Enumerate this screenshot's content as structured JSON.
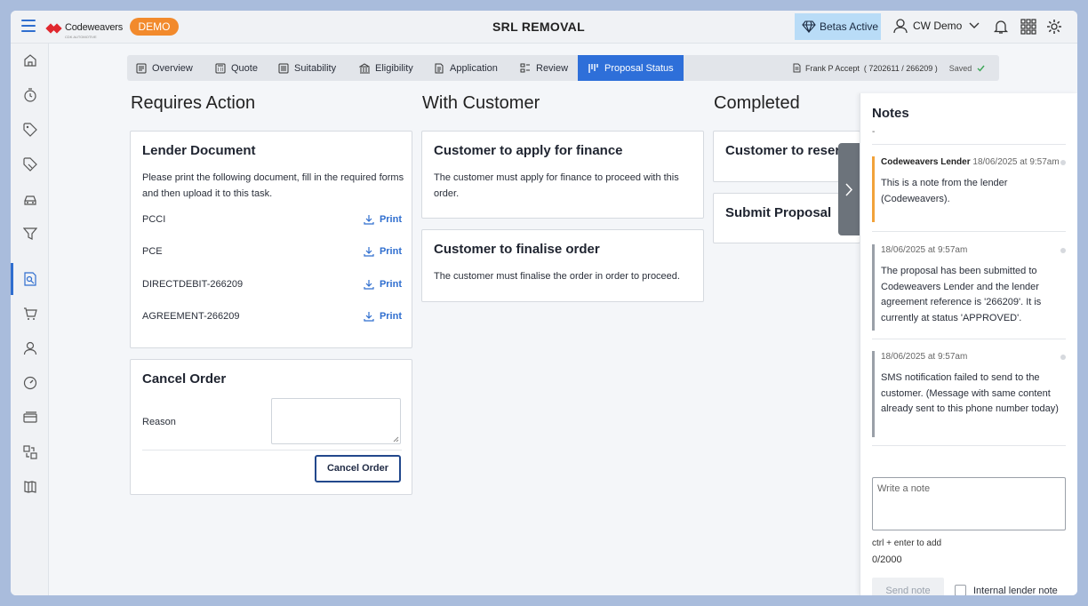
{
  "header": {
    "brand": "Codeweavers",
    "brand_sub": "CDK AUTOMOTIVE",
    "demo_badge": "DEMO",
    "title": "SRL REMOVAL",
    "betas_label": "Betas Active",
    "user_name": "CW Demo",
    "icons": [
      "menu-icon",
      "diamond-icon",
      "user-icon",
      "chevron-down-icon",
      "bell-icon",
      "apps-grid-icon",
      "gear-icon"
    ]
  },
  "sidebar": {
    "items": [
      "home-icon",
      "timer-icon",
      "tag-icon",
      "tag-edit-icon",
      "car-icon",
      "filter-icon",
      "proposal-search-icon",
      "cart-icon",
      "person-icon",
      "speedometer-icon",
      "card-icon",
      "swap-icon",
      "map-icon"
    ],
    "active_index": 6
  },
  "tabs": [
    {
      "label": "Overview",
      "icon": "overview-icon"
    },
    {
      "label": "Quote",
      "icon": "calculator-icon"
    },
    {
      "label": "Suitability",
      "icon": "checklist-icon"
    },
    {
      "label": "Eligibility",
      "icon": "bank-icon"
    },
    {
      "label": "Application",
      "icon": "form-icon"
    },
    {
      "label": "Review",
      "icon": "review-icon"
    },
    {
      "label": "Proposal Status",
      "icon": "status-icon",
      "active": true
    }
  ],
  "proposal_info": {
    "customer": "Frank P Accept",
    "reference": "( 7202611 / 266209 )",
    "saved_label": "Saved",
    "accent_color": "#2e6fd9"
  },
  "columns": {
    "requires_action": "Requires Action",
    "with_customer": "With Customer",
    "completed": "Completed"
  },
  "lender_document": {
    "title": "Lender Document",
    "text": "Please print the following document, fill in the required forms and then upload it to this task.",
    "print_label": "Print",
    "documents": [
      "PCCI",
      "PCE",
      "DIRECTDEBIT-266209",
      "AGREEMENT-266209"
    ]
  },
  "cancel_order": {
    "title": "Cancel Order",
    "reason_label": "Reason",
    "button_label": "Cancel Order"
  },
  "with_customer_cards": [
    {
      "title": "Customer to apply for finance",
      "text": "The customer must apply for finance to proceed with this order."
    },
    {
      "title": "Customer to finalise order",
      "text": "The customer must finalise the order in order to proceed."
    }
  ],
  "completed_cards": [
    {
      "title": "Customer to reser"
    },
    {
      "title": "Submit Proposal"
    }
  ],
  "notes": {
    "title": "Notes",
    "dash": "-",
    "items": [
      {
        "author": "Codeweavers Lender",
        "time": "18/06/2025 at 9:57am",
        "body": "This is a note from the lender (Codeweavers).",
        "color": "#f2a23a"
      },
      {
        "author": "",
        "time": "18/06/2025 at 9:57am",
        "body": "The proposal has been submitted to Codeweavers Lender and the lender agreement reference is '266209'. It is currently at status 'APPROVED'.",
        "color": "#9aa0a8"
      },
      {
        "author": "",
        "time": "18/06/2025 at 9:57am",
        "body": "SMS notification failed to send to the customer. (Message with same content already sent to this phone number today)",
        "color": "#9aa0a8"
      }
    ],
    "input_placeholder": "Write a note",
    "hint": "ctrl + enter to add",
    "counter": "0/2000",
    "send_label": "Send note",
    "internal_label": "Internal lender note"
  }
}
